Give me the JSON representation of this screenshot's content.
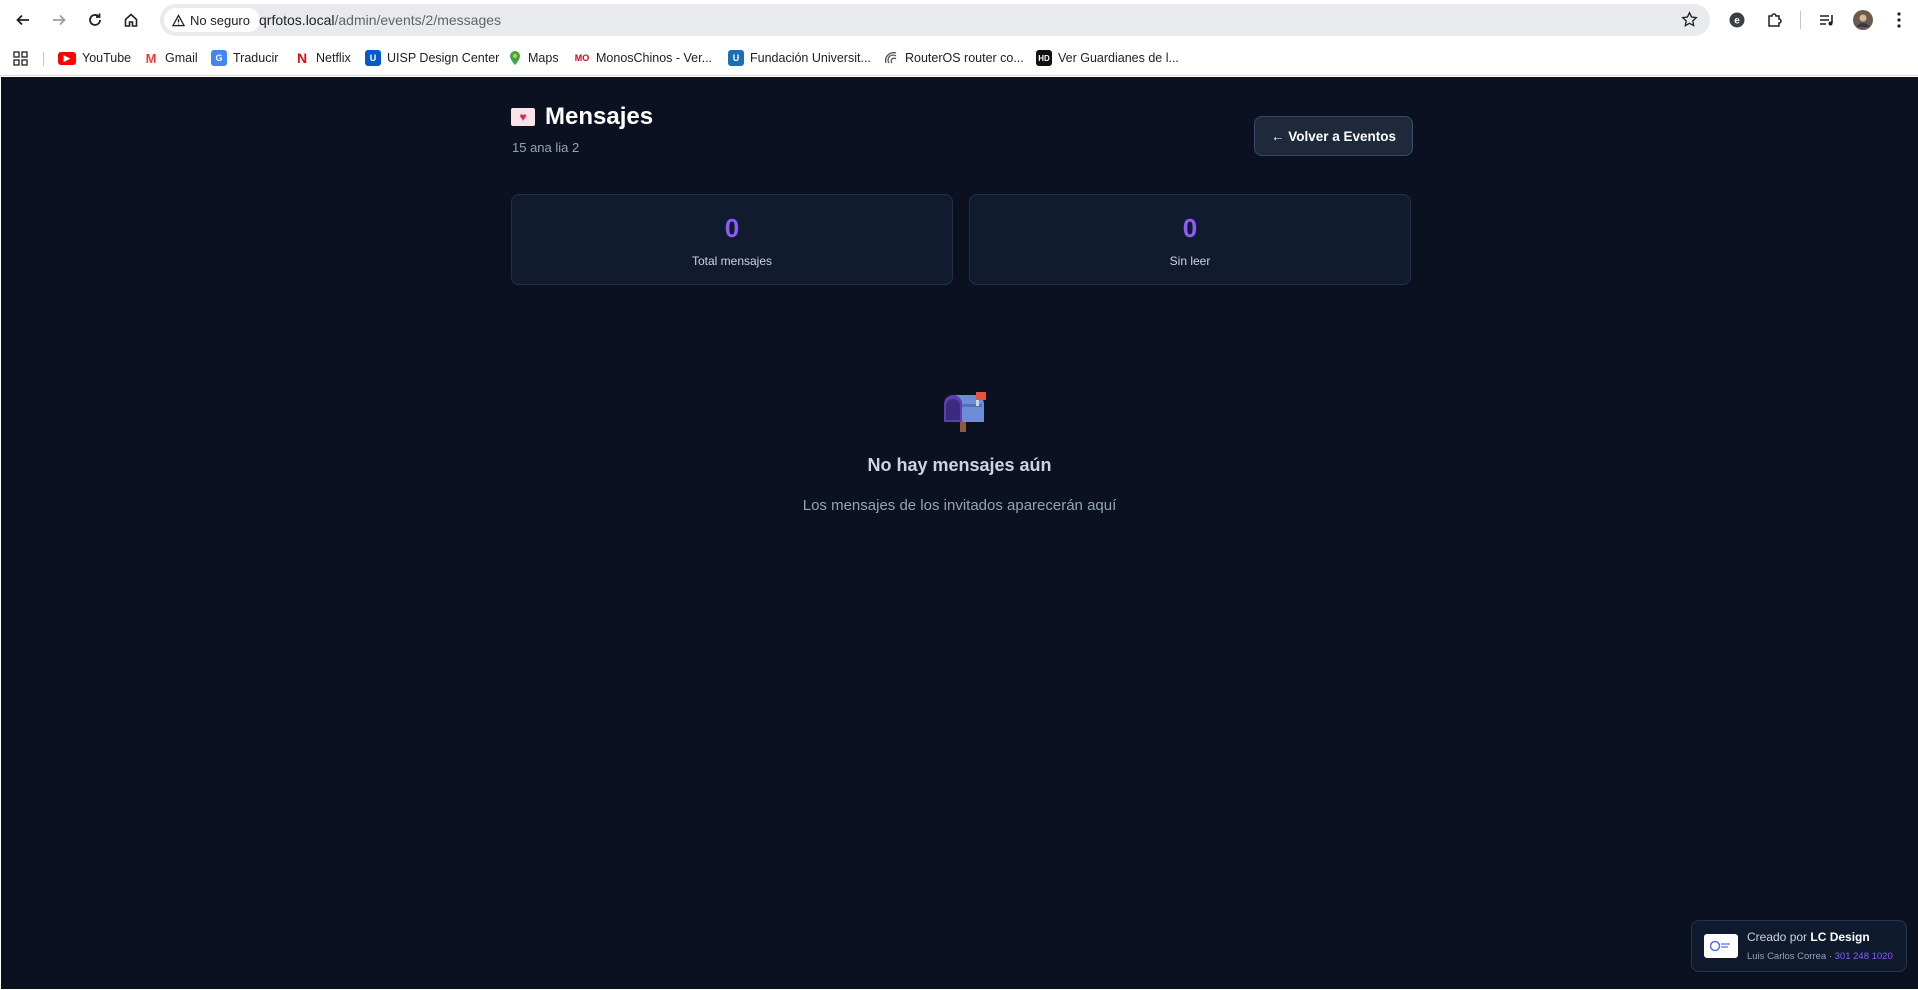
{
  "browser": {
    "security_label": "No seguro",
    "url_host": "qrfotos.local",
    "url_path": "/admin/events/2/messages",
    "bookmarks": [
      {
        "label": "YouTube",
        "icon": "youtube-icon"
      },
      {
        "label": "Gmail",
        "icon": "gmail-icon"
      },
      {
        "label": "Traducir",
        "icon": "translate-icon"
      },
      {
        "label": "Netflix",
        "icon": "netflix-icon"
      },
      {
        "label": "UISP Design Center",
        "icon": "uisp-icon"
      },
      {
        "label": "Maps",
        "icon": "maps-icon"
      },
      {
        "label": "MonosChinos - Ver...",
        "icon": "monoschinos-icon"
      },
      {
        "label": "Fundación Universit...",
        "icon": "fundacion-icon"
      },
      {
        "label": "RouterOS router co...",
        "icon": "routeros-icon"
      },
      {
        "label": "Ver Guardianes de l...",
        "icon": "hd-icon"
      }
    ]
  },
  "header": {
    "icon": "love-letter-icon",
    "title": "Mensajes",
    "subtitle": "15 ana lia 2",
    "back_button": "← Volver a Eventos"
  },
  "stats": [
    {
      "value": "0",
      "label": "Total mensajes"
    },
    {
      "value": "0",
      "label": "Sin leer"
    }
  ],
  "empty_state": {
    "icon": "mailbox-icon",
    "title": "No hay mensajes aún",
    "description": "Los mensajes de los invitados aparecerán aquí"
  },
  "footer_credit": {
    "prefix": "Creado por ",
    "brand": "LC Design",
    "author": "Luis Carlos Correa · ",
    "phone": "301 248 1020"
  },
  "colors": {
    "page_bg": "#0b1120",
    "card_bg": "#111b30",
    "accent": "#8b5cf6"
  }
}
